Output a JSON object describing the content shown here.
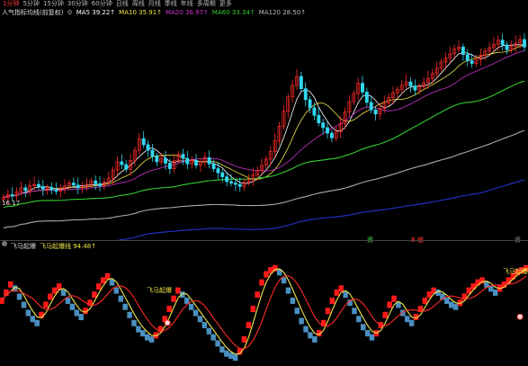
{
  "colors": {
    "up": "#ff2a2a",
    "down": "#33d6f0",
    "ma5": "#ffffff",
    "ma10": "#f2e64a",
    "ma20": "#cc33cc",
    "ma60": "#33cc33",
    "ma120": "#aaaaaa",
    "ma250": "#2233cc",
    "osc_up": "#ff1a1a",
    "osc_down": "#4a8fbf",
    "fast": "#f2e64a",
    "slow": "#ff2a2a"
  },
  "tabs": [
    {
      "label": "1分钟",
      "active": true
    },
    {
      "label": "5分钟"
    },
    {
      "label": "15分钟"
    },
    {
      "label": "30分钟"
    },
    {
      "label": "60分钟"
    },
    {
      "label": "日线"
    },
    {
      "label": "周线"
    },
    {
      "label": "月线"
    },
    {
      "label": "季线"
    },
    {
      "label": "年线"
    },
    {
      "label": "多周期"
    },
    {
      "label": "更多"
    }
  ],
  "ma_bar": {
    "title": "人气指标均线(前复权)",
    "ma5": "MA5 39.22↑",
    "ma10": "MA10 35.91↑",
    "ma20": "MA20 36.97↑",
    "ma60": "MA60 33.34↑",
    "ma120": "MA120 28.50↑"
  },
  "price_label": "16.17",
  "markers": [
    {
      "text": "资",
      "color": "#44dd44"
    },
    {
      "text": "B 撤",
      "color": "#ff3333"
    },
    {
      "text": "资",
      "color": "#888888"
    }
  ],
  "indicator": {
    "name": "飞马起爆",
    "value_label": "飞马起爆线 94.48↑",
    "signal1": "飞马起爆",
    "signal2": "飞马起爆"
  },
  "chart_data": {
    "type": "candlestick",
    "x": [
      0,
      1,
      2,
      3,
      4,
      5,
      6,
      7,
      8,
      9,
      10,
      11,
      12,
      13,
      14,
      15,
      16,
      17,
      18,
      19,
      20,
      21,
      22,
      23,
      24,
      25,
      26,
      27,
      28,
      29,
      30,
      31,
      32,
      33,
      34,
      35,
      36,
      37,
      38,
      39,
      40,
      41,
      42,
      43,
      44,
      45,
      46,
      47,
      48,
      49,
      50,
      51,
      52,
      53,
      54,
      55,
      56,
      57,
      58,
      59,
      60,
      61,
      62,
      63,
      64,
      65,
      66,
      67,
      68,
      69,
      70,
      71,
      72,
      73,
      74,
      75,
      76,
      77,
      78,
      79,
      80,
      81,
      82,
      83,
      84,
      85,
      86,
      87,
      88,
      89,
      90,
      91,
      92,
      93,
      94,
      95,
      96,
      97,
      98,
      99,
      100,
      101,
      102,
      103,
      104,
      105,
      106,
      107,
      108,
      109,
      110,
      111,
      112,
      113,
      114,
      115,
      116,
      117,
      118,
      119
    ],
    "close": [
      17.2,
      17.6,
      17.4,
      18.0,
      18.6,
      18.2,
      18.9,
      19.1,
      18.8,
      18.4,
      18.6,
      18.3,
      18.1,
      18.5,
      18.9,
      19.3,
      19.0,
      18.6,
      18.8,
      19.1,
      19.6,
      19.2,
      18.9,
      19.4,
      20.0,
      21.2,
      22.4,
      22.0,
      21.3,
      22.6,
      24.1,
      25.8,
      24.9,
      24.1,
      23.2,
      22.4,
      22.9,
      22.2,
      21.4,
      22.6,
      23.5,
      22.9,
      22.1,
      22.6,
      21.9,
      22.4,
      23.0,
      22.1,
      21.4,
      20.8,
      20.2,
      19.5,
      19.3,
      19.1,
      18.8,
      19.4,
      19.8,
      20.5,
      21.1,
      21.9,
      22.8,
      23.9,
      25.5,
      27.6,
      29.8,
      31.9,
      33.6,
      34.9,
      33.1,
      31.5,
      30.3,
      29.2,
      28.1,
      27.4,
      26.6,
      25.9,
      26.8,
      28.0,
      29.7,
      31.2,
      32.4,
      33.9,
      32.6,
      31.1,
      30.0,
      29.4,
      30.2,
      31.0,
      31.8,
      32.5,
      33.0,
      33.6,
      34.1,
      33.5,
      32.9,
      33.4,
      34.0,
      34.6,
      35.3,
      36.1,
      37.0,
      37.6,
      38.2,
      38.9,
      39.2,
      38.1,
      37.2,
      36.8,
      37.4,
      38.0,
      38.6,
      39.1,
      39.6,
      40.2,
      39.5,
      38.8,
      39.3,
      39.8,
      40.3,
      39.2
    ],
    "series_names": [
      "MA5",
      "MA10",
      "MA20",
      "MA60",
      "MA120",
      "MA250"
    ],
    "oscillator": {
      "name": "飞马起爆",
      "values": [
        62,
        70,
        78,
        74,
        66,
        58,
        50,
        44,
        40,
        48,
        58,
        66,
        72,
        76,
        70,
        62,
        56,
        50,
        46,
        52,
        60,
        68,
        76,
        82,
        86,
        80,
        72,
        64,
        56,
        48,
        40,
        34,
        30,
        26,
        24,
        28,
        34,
        44,
        54,
        64,
        72,
        68,
        62,
        56,
        50,
        44,
        38,
        32,
        26,
        20,
        14,
        10,
        8,
        6,
        12,
        24,
        38,
        54,
        68,
        80,
        88,
        92,
        94,
        90,
        82,
        72,
        62,
        52,
        42,
        34,
        28,
        24,
        30,
        40,
        52,
        62,
        70,
        74,
        68,
        60,
        52,
        44,
        36,
        30,
        26,
        30,
        38,
        48,
        58,
        64,
        58,
        50,
        44,
        40,
        46,
        54,
        62,
        68,
        72,
        70,
        66,
        62,
        58,
        56,
        60,
        66,
        72,
        76,
        80,
        82,
        78,
        74,
        70,
        74,
        78,
        82,
        86,
        90,
        92,
        94
      ]
    }
  }
}
